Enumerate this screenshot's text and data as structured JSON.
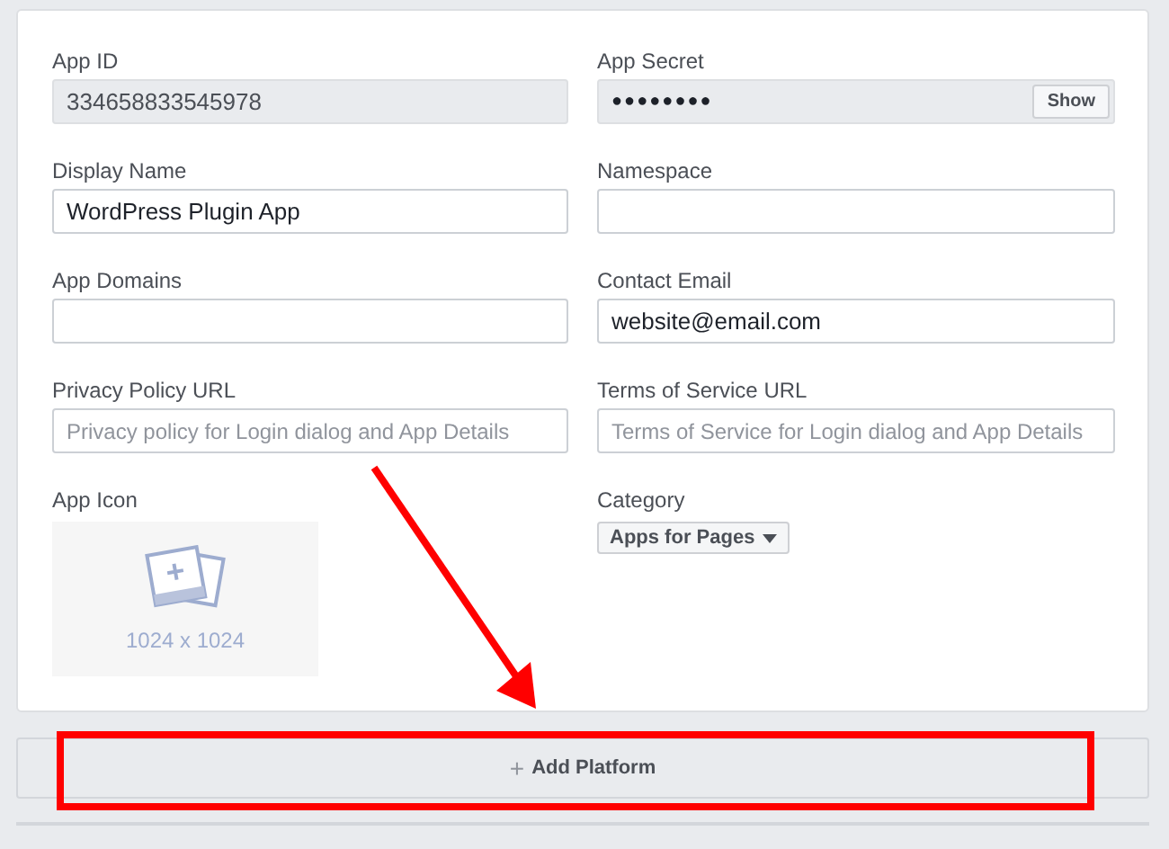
{
  "fields": [
    {
      "kind": "readonly",
      "label": "App ID",
      "value": "334658833545978"
    },
    {
      "kind": "secret",
      "label": "App Secret",
      "value": "●●●●●●●●",
      "button": "Show"
    },
    {
      "kind": "text",
      "label": "Display Name",
      "value": "WordPress Plugin App"
    },
    {
      "kind": "text",
      "label": "Namespace"
    },
    {
      "kind": "text",
      "label": "App Domains"
    },
    {
      "kind": "text",
      "label": "Contact Email",
      "value": "website@email.com"
    },
    {
      "kind": "text",
      "label": "Privacy Policy URL",
      "placeholder": "Privacy policy for Login dialog and App Details"
    },
    {
      "kind": "text",
      "label": "Terms of Service URL",
      "placeholder": "Terms of Service for Login dialog and App Details"
    },
    {
      "kind": "image",
      "label": "App Icon",
      "caption": "1024 x 1024"
    },
    {
      "kind": "select",
      "label": "Category",
      "value": "Apps for Pages"
    }
  ],
  "add_platform": {
    "icon": "+",
    "label": "Add Platform"
  }
}
